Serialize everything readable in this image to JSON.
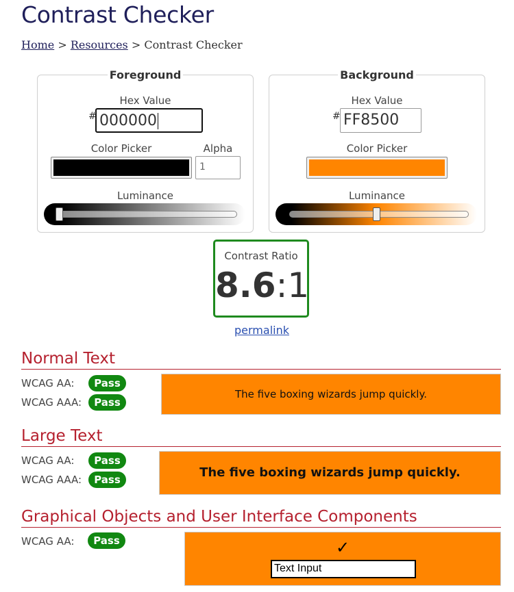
{
  "page": {
    "title": "Contrast Checker"
  },
  "breadcrumb": {
    "home": "Home",
    "sep1": " > ",
    "resources": "Resources",
    "sep2": " > ",
    "current": "Contrast Checker"
  },
  "foreground": {
    "legend": "Foreground",
    "hex_label": "Hex Value",
    "hash": "#",
    "hex_value": "000000",
    "picker_label": "Color Picker",
    "color": "#000000",
    "alpha_label": "Alpha",
    "alpha_value": "1",
    "luminance_label": "Luminance",
    "luminance_level": 0.0
  },
  "background": {
    "legend": "Background",
    "hex_label": "Hex Value",
    "hash": "#",
    "hex_value": "FF8500",
    "picker_label": "Color Picker",
    "color": "#FF8500",
    "luminance_label": "Luminance",
    "luminance_level": 0.49
  },
  "ratio": {
    "label": "Contrast Ratio",
    "main": "8.6",
    "suffix": ":1",
    "permalink": "permalink"
  },
  "normal_text": {
    "heading": "Normal Text",
    "aa_label": "WCAG AA:",
    "aa_result": "Pass",
    "aaa_label": "WCAG AAA:",
    "aaa_result": "Pass",
    "sample": "The five boxing wizards jump quickly."
  },
  "large_text": {
    "heading": "Large Text",
    "aa_label": "WCAG AA:",
    "aa_result": "Pass",
    "aaa_label": "WCAG AAA:",
    "aaa_result": "Pass",
    "sample": "The five boxing wizards jump quickly."
  },
  "graphical": {
    "heading": "Graphical Objects and User Interface Components",
    "aa_label": "WCAG AA:",
    "aa_result": "Pass",
    "check_glyph": "✓",
    "input_value": "Text Input"
  },
  "colors": {
    "accent_red": "#b5202e",
    "pass_green": "#118811",
    "ratio_border": "#1e8a1e",
    "sample_bg": "#FF8500"
  }
}
